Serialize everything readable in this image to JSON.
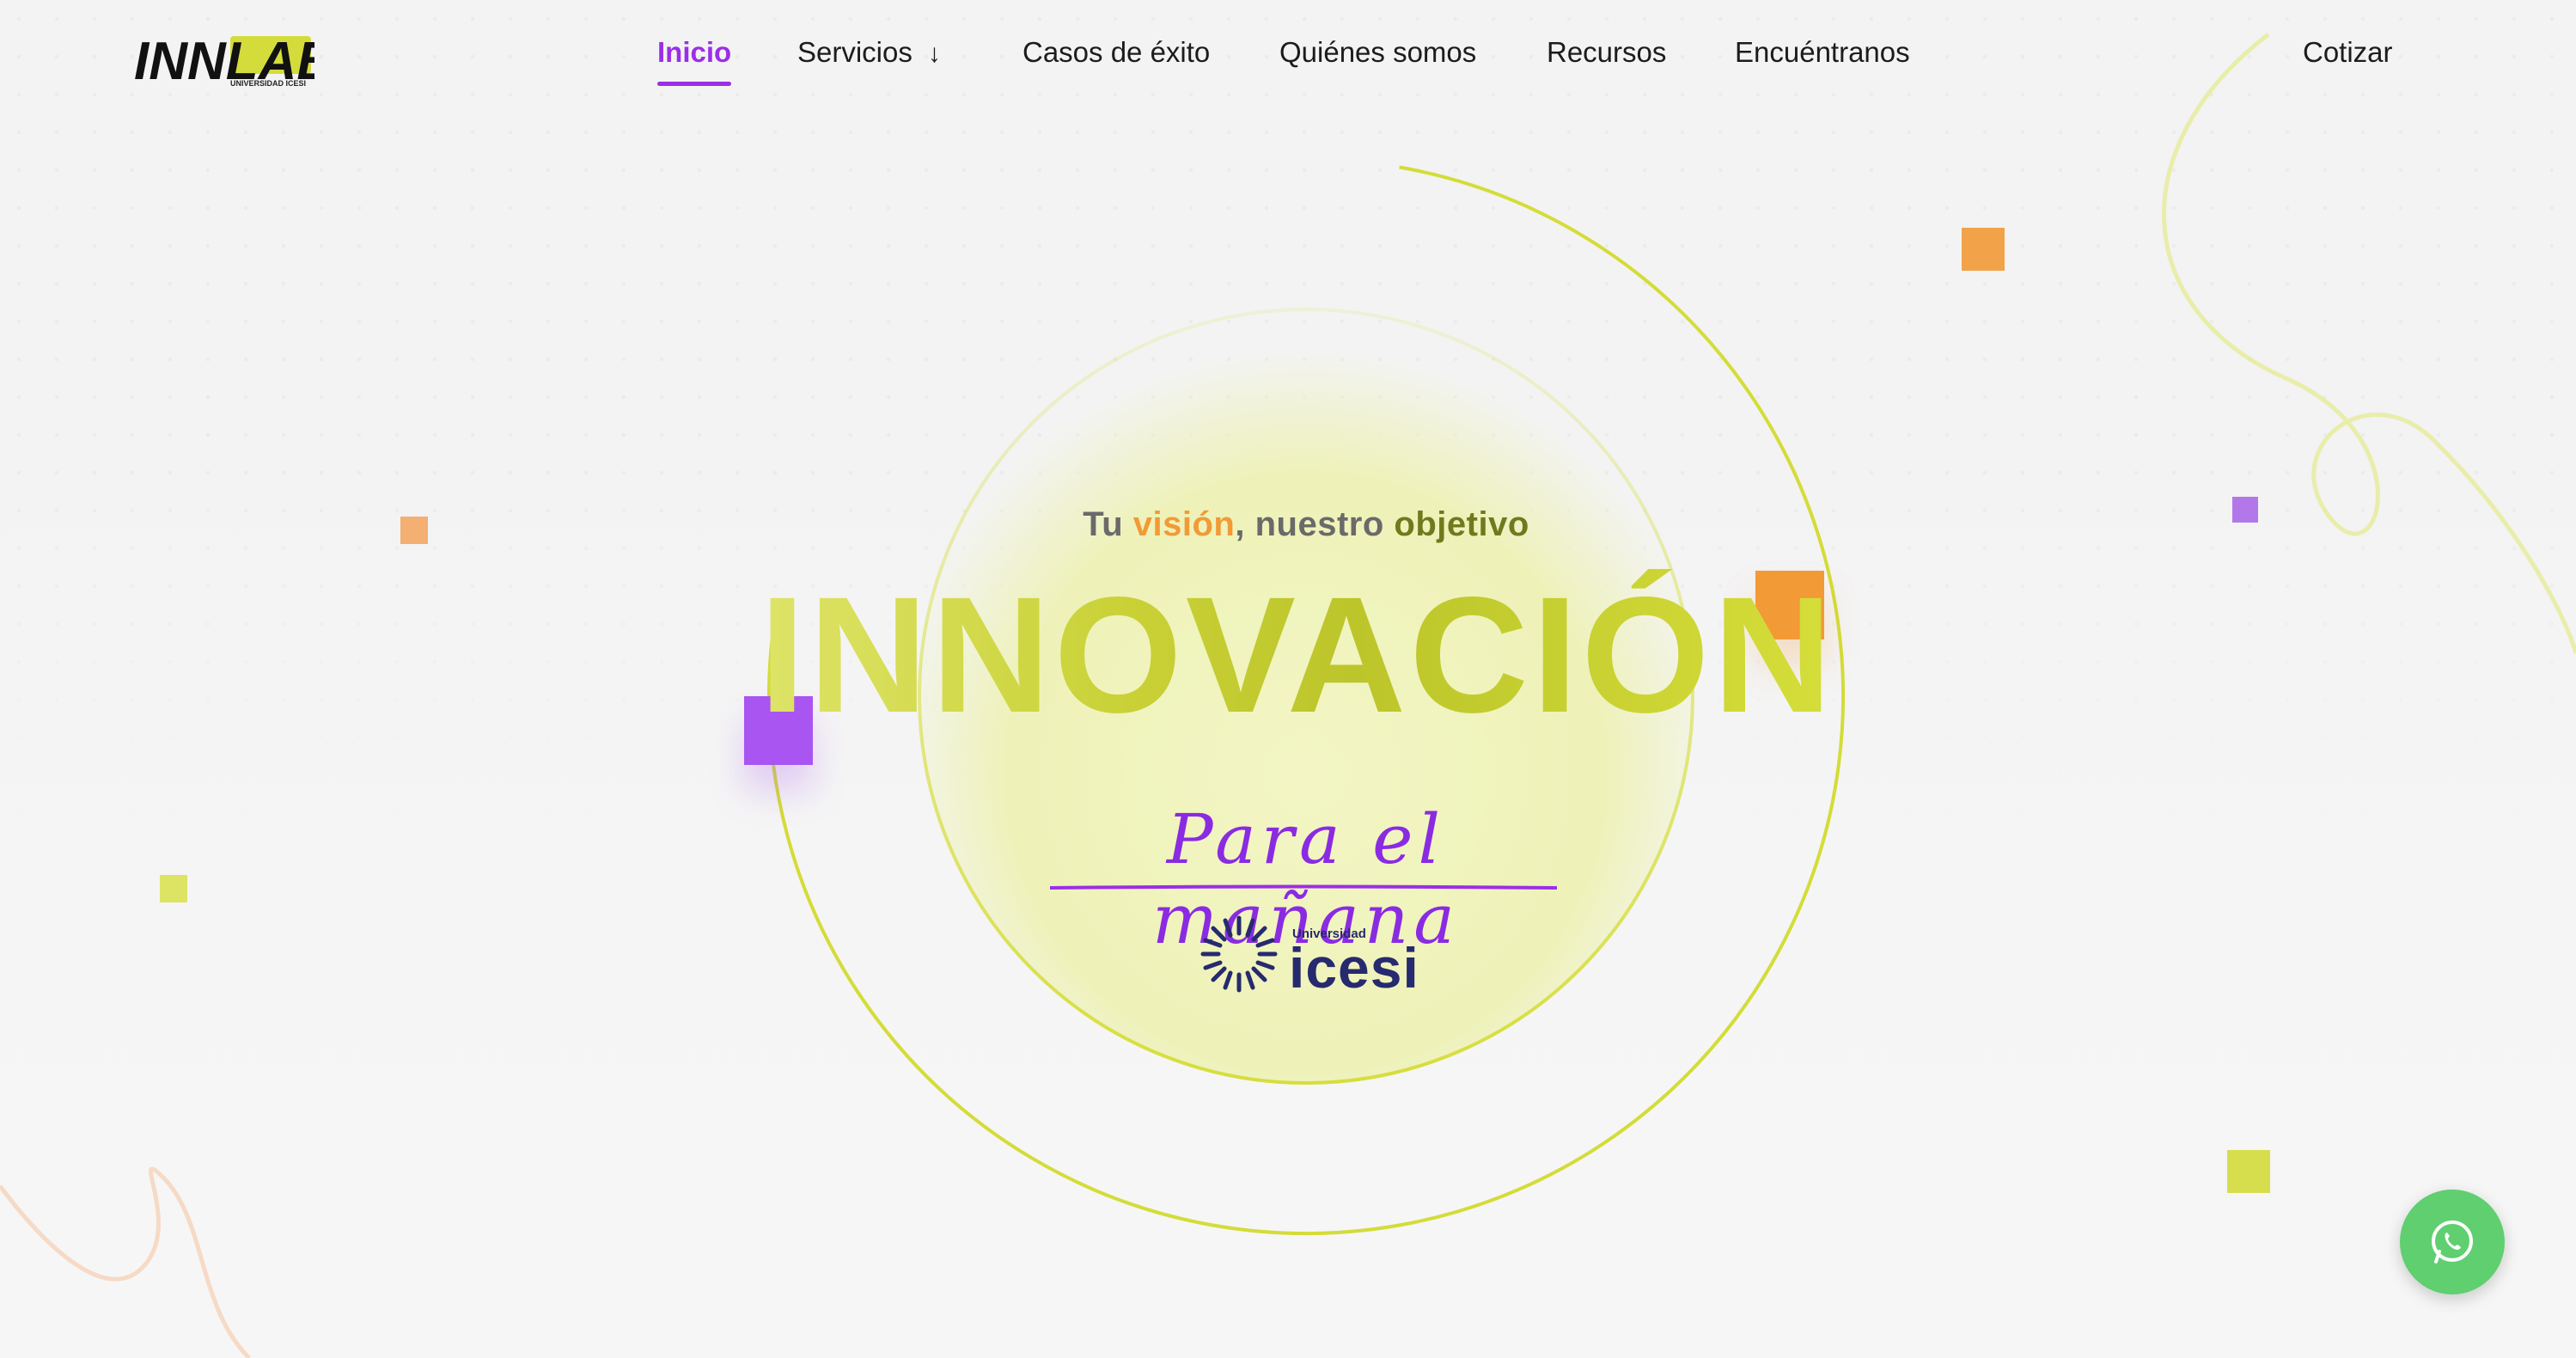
{
  "header": {
    "logo_text": "INNLAB",
    "logo_subtext": "UNIVERSIDAD ICESI",
    "nav": [
      {
        "label": "Inicio",
        "active": true
      },
      {
        "label": "Servicios",
        "has_dropdown": true
      },
      {
        "label": "Casos de éxito"
      },
      {
        "label": "Quiénes somos"
      },
      {
        "label": "Recursos"
      },
      {
        "label": "Encuéntranos"
      }
    ],
    "cta_label": "Cotizar"
  },
  "hero": {
    "tagline_pre": "Tu",
    "tagline_vision": "visión",
    "tagline_mid": ", nuestro",
    "tagline_objetivo": "objetivo",
    "title": "INNOVACIÓN",
    "script": "Para el mañana",
    "partner_logo_small": "Universidad",
    "partner_logo_word": "icesi"
  },
  "floating_action": {
    "icon": "whatsapp-icon"
  },
  "colors": {
    "accent_purple": "#9b2ee6",
    "lime": "#d4dc3c",
    "orange": "#f29a36",
    "olive": "#6f7a1e",
    "whatsapp_green": "#5fcf6f",
    "icesi_navy": "#262a6e"
  }
}
